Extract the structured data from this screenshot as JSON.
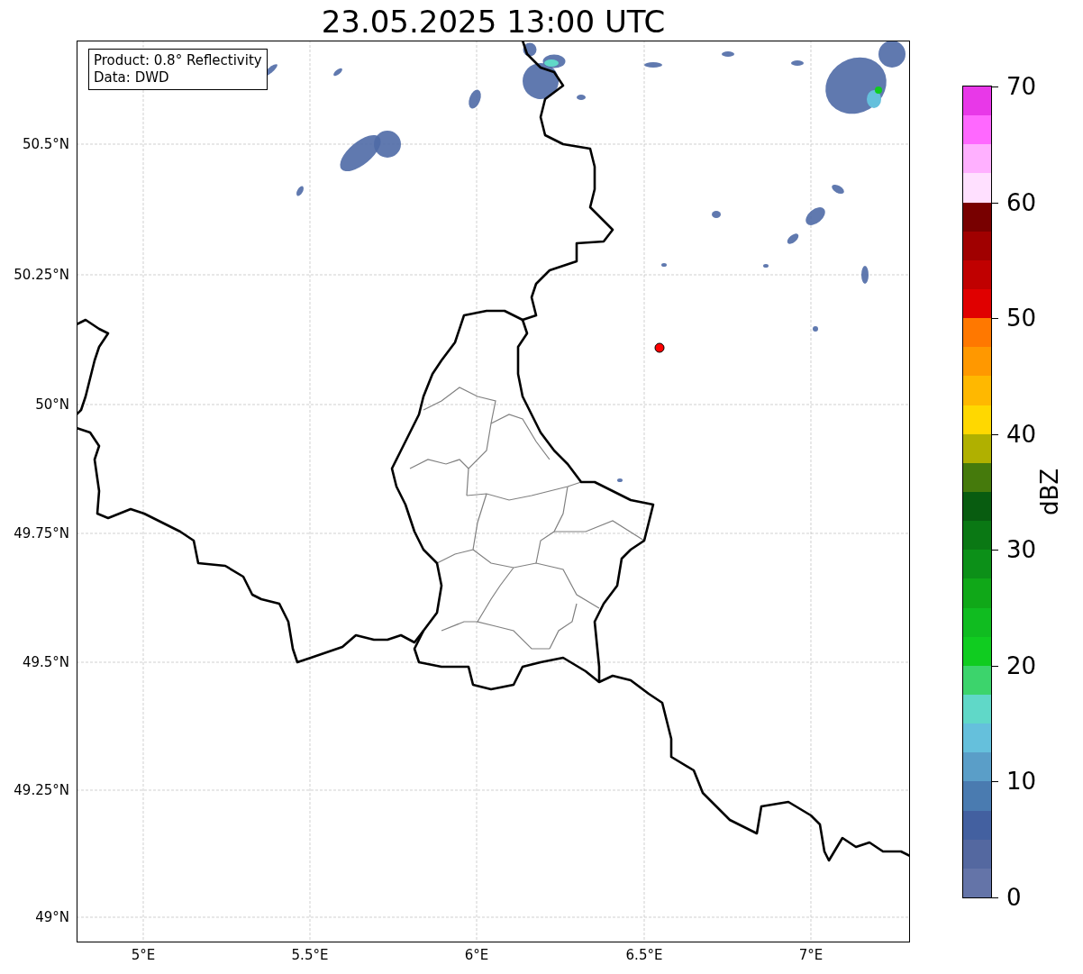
{
  "title": "23.05.2025 13:00 UTC",
  "info_box": [
    "Product: 0.8° Reflectivity",
    "Data: DWD"
  ],
  "lat_labels": [
    "50.5°N",
    "50.25°N",
    "50°N",
    "49.75°N",
    "49.5°N",
    "49.25°N",
    "49°N"
  ],
  "lon_labels": [
    "5°E",
    "5.5°E",
    "6°E",
    "6.5°E",
    "7°E"
  ],
  "colorbar": {
    "label": "dBZ",
    "ticks": [
      "70",
      "60",
      "50",
      "40",
      "30",
      "20",
      "10",
      "0"
    ],
    "bands": [
      {
        "color": "#e838e8"
      },
      {
        "color": "#ff68ff"
      },
      {
        "color": "#ffb0ff"
      },
      {
        "color": "#ffe0ff"
      },
      {
        "color": "#780000"
      },
      {
        "color": "#a00000"
      },
      {
        "color": "#c00000"
      },
      {
        "color": "#e00000"
      },
      {
        "color": "#ff7800"
      },
      {
        "color": "#ff9800"
      },
      {
        "color": "#ffb800"
      },
      {
        "color": "#ffd800"
      },
      {
        "color": "#b0b000"
      },
      {
        "color": "#457a0c"
      },
      {
        "color": "#085c10"
      },
      {
        "color": "#0a7814"
      },
      {
        "color": "#0c9018"
      },
      {
        "color": "#10a818"
      },
      {
        "color": "#10bc20"
      },
      {
        "color": "#10cc20"
      },
      {
        "color": "#3cd46c"
      },
      {
        "color": "#60d8c8"
      },
      {
        "color": "#65c0dc"
      },
      {
        "color": "#5a9ec8"
      },
      {
        "color": "#4a7bb0"
      },
      {
        "color": "#4360a0"
      },
      {
        "color": "#5468a0"
      },
      {
        "color": "#6474a8"
      }
    ]
  }
}
